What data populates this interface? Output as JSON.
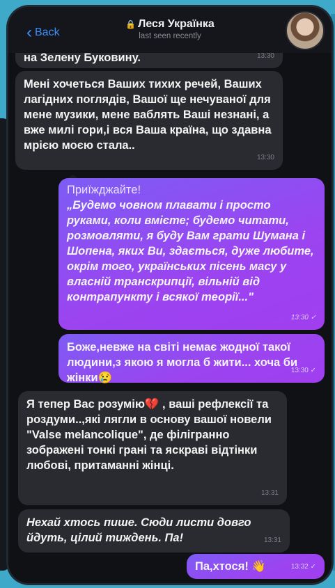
{
  "header": {
    "back_label": "Back",
    "title": "Леся Українка",
    "status": "last seen recently"
  },
  "messages": [
    {
      "id": "m0",
      "direction": "in",
      "text": "на Зелену Буковину.",
      "time": "13:30"
    },
    {
      "id": "m1",
      "direction": "in",
      "text": "Мені хочеться Ваших тихих речей, Ваших лагідних поглядів, Вашої ще нечуваної для мене музики, мене ваблять Ваші незнані, а вже милі гори,і вся Ваша країна, що здавна мрією моєю стала..",
      "time": "13:30"
    },
    {
      "id": "m2",
      "direction": "out",
      "head": "Приїжджайте!",
      "text": "„Будемо човном плавати і просто руками, коли вмієте; будемо читати, розмовляти, я буду Вам грати Шумана і Шопена, яких Ви, здається, дуже любите, окрім того, українських пісень масу у власній транскрипції, вільній від контрапункту і всякої теорії...\"",
      "time": "13:30 ✓"
    },
    {
      "id": "m3",
      "direction": "out",
      "text": "Боже,невже на світі немає жодної такої людини,з якою я могла б жити... хоча би жінки😢",
      "time": "13:30 ✓"
    },
    {
      "id": "m4",
      "direction": "in",
      "text": "Я тепер Вас розумію💔 , ваші рефлексії та роздуми..,які лягли в основу вашої новели \"Valse melancolique\", де філігранно зображені тонкі грані та яскраві відтінки любові, притаманні жінці.",
      "time": "13:31"
    },
    {
      "id": "m5",
      "direction": "in",
      "text": "Нехай хтось пише. Сюди листи довго йдуть, цілий тиждень. Па!",
      "time": "13:31"
    },
    {
      "id": "m6",
      "direction": "out",
      "text": "Па,хтося! 👋",
      "time": "13:32 ✓"
    }
  ],
  "colors": {
    "accent": "#3d8ef7",
    "bubble_in": "#2a2b30",
    "bubble_out": "#8b4ff2",
    "background": "#3fa9c9"
  }
}
